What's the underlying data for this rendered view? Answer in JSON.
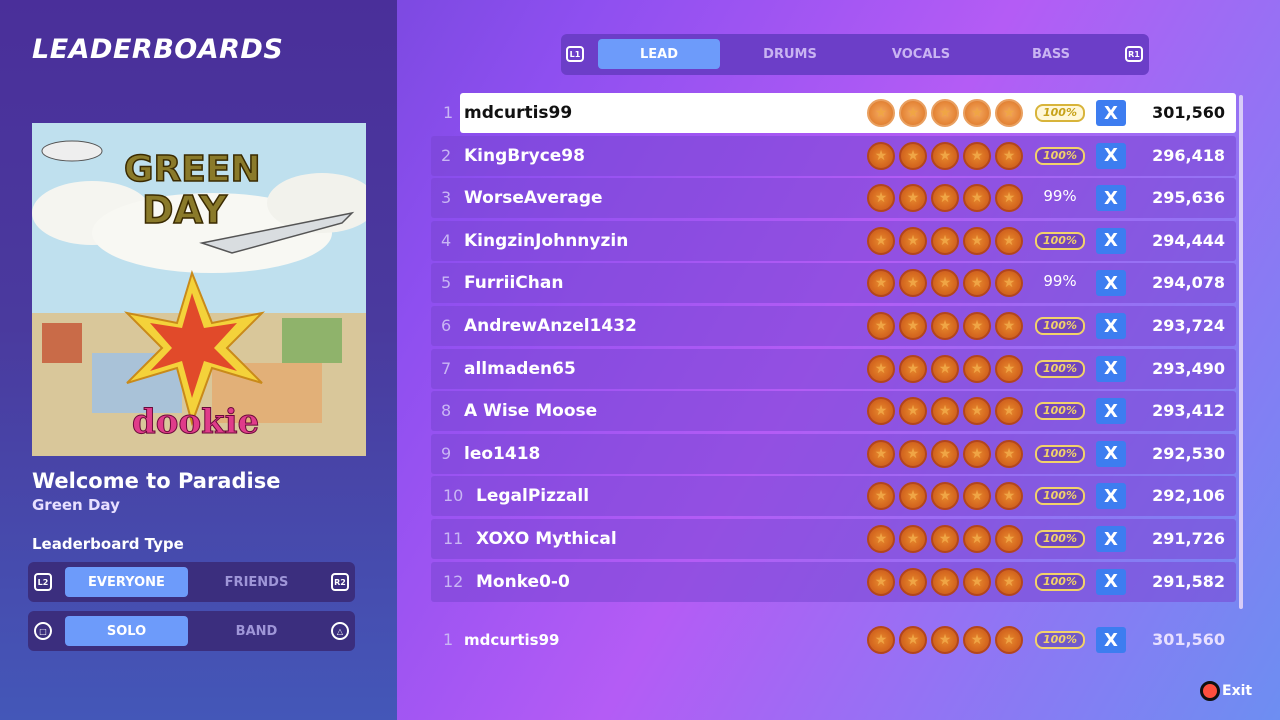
{
  "page_title": "LEADERBOARDS",
  "song": {
    "title": "Welcome to Paradise",
    "artist": "Green Day"
  },
  "leaderboard_type_label": "Leaderboard Type",
  "scope_toggle": {
    "left_hint": "L2",
    "right_hint": "R2",
    "options": [
      "EVERYONE",
      "FRIENDS"
    ],
    "active": "EVERYONE"
  },
  "mode_toggle": {
    "left_hint": "□",
    "right_hint": "△",
    "options": [
      "SOLO",
      "BAND"
    ],
    "active": "SOLO"
  },
  "instrument_tabs": {
    "left_hint": "L1",
    "right_hint": "R1",
    "tabs": [
      "LEAD",
      "DRUMS",
      "VOCALS",
      "BASS"
    ],
    "active": "LEAD"
  },
  "rows": [
    {
      "rank": "1",
      "name": "mdcurtis99",
      "stars": 5,
      "accuracy": "100%",
      "fc": true,
      "x": "X",
      "score": "301,560"
    },
    {
      "rank": "2",
      "name": "KingBryce98",
      "stars": 5,
      "accuracy": "100%",
      "fc": true,
      "x": "X",
      "score": "296,418"
    },
    {
      "rank": "3",
      "name": "WorseAverage",
      "stars": 5,
      "accuracy": "99%",
      "fc": false,
      "x": "X",
      "score": "295,636"
    },
    {
      "rank": "4",
      "name": "KingzinJohnnyzin",
      "stars": 5,
      "accuracy": "100%",
      "fc": true,
      "x": "X",
      "score": "294,444"
    },
    {
      "rank": "5",
      "name": "FurriiChan",
      "stars": 5,
      "accuracy": "99%",
      "fc": false,
      "x": "X",
      "score": "294,078"
    },
    {
      "rank": "6",
      "name": "AndrewAnzel1432",
      "stars": 5,
      "accuracy": "100%",
      "fc": true,
      "x": "X",
      "score": "293,724"
    },
    {
      "rank": "7",
      "name": "allmaden65",
      "stars": 5,
      "accuracy": "100%",
      "fc": true,
      "x": "X",
      "score": "293,490"
    },
    {
      "rank": "8",
      "name": "A Wise Moose",
      "stars": 5,
      "accuracy": "100%",
      "fc": true,
      "x": "X",
      "score": "293,412"
    },
    {
      "rank": "9",
      "name": "leo1418",
      "stars": 5,
      "accuracy": "100%",
      "fc": true,
      "x": "X",
      "score": "292,530"
    },
    {
      "rank": "10",
      "name": "LegalPizzall",
      "stars": 5,
      "accuracy": "100%",
      "fc": true,
      "x": "X",
      "score": "292,106"
    },
    {
      "rank": "11",
      "name": "XOXO Mythical",
      "stars": 5,
      "accuracy": "100%",
      "fc": true,
      "x": "X",
      "score": "291,726"
    },
    {
      "rank": "12",
      "name": "Monke0-0",
      "stars": 5,
      "accuracy": "100%",
      "fc": true,
      "x": "X",
      "score": "291,582"
    }
  ],
  "player_entry": {
    "rank": "1",
    "name": "mdcurtis99",
    "stars": 5,
    "accuracy": "100%",
    "x": "X",
    "score": "301,560"
  },
  "exit_label": "Exit",
  "album_art": {
    "band_text": "GREEN DAY",
    "album_text": "dookie"
  },
  "icons": {
    "star": "star-medal-icon",
    "x": "x-badge-icon",
    "exit": "circle-button-icon"
  },
  "colors": {
    "accent": "#6d9bfa",
    "x_badge": "#3d7df0",
    "gold": "#f2d26a"
  }
}
